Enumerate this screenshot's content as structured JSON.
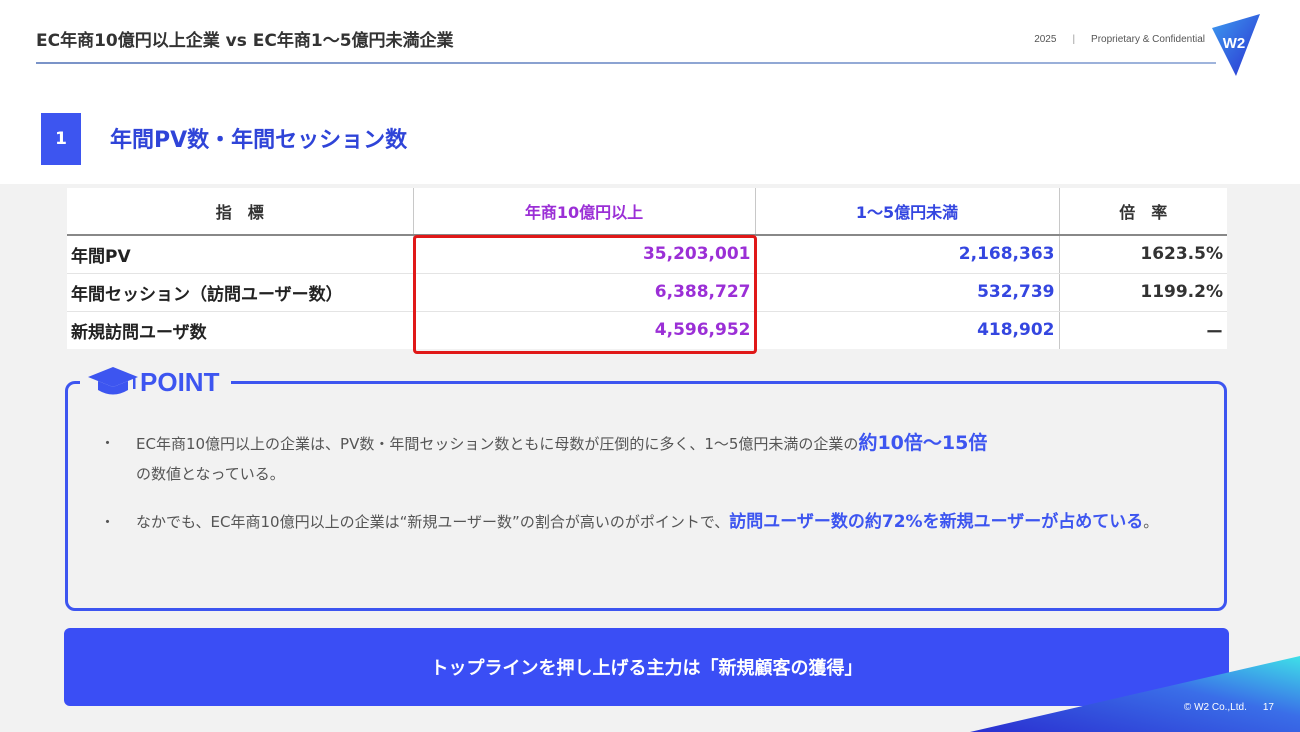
{
  "header": {
    "title": "EC年商10億円以上企業 vs EC年商1～5億円未満企業",
    "year": "2025",
    "separator": "|",
    "confidential": "Proprietary & Confidential",
    "logo_text": "W2"
  },
  "section": {
    "number": "1",
    "title": "年間PV数・年間セッション数"
  },
  "table": {
    "headers": [
      "指　標",
      "年商10億円以上",
      "1～5億円未満",
      "倍　率"
    ],
    "rows": [
      {
        "metric": "年間PV",
        "big": "35,203,001",
        "small": "2,168,363",
        "ratio": "1623.5%"
      },
      {
        "metric": "年間セッション（訪問ユーザー数）",
        "big": "6,388,727",
        "small": "532,739",
        "ratio": "1199.2%"
      },
      {
        "metric": "新規訪問ユーザ数",
        "big": "4,596,952",
        "small": "418,902",
        "ratio": "ー"
      }
    ]
  },
  "point": {
    "label": "POINT",
    "bullet_mark": "・",
    "bullet1": {
      "text": "EC年商10億円以上の企業は、PV数・年間セッション数ともに母数が圧倒的に多く、1～5億円未満の企業の",
      "emphasis": "約10倍～15倍",
      "text_after": "の数値となっている。"
    },
    "bullet2": {
      "text": "なかでも、EC年商10億円以上の企業は“新規ユーザー数”の割合が高いのがポイントで、",
      "emphasis": "訪問ユーザー数の約72%を新規ユーザーが占めている",
      "text_after": "。"
    }
  },
  "conclusion": "トップラインを押し上げる主力は「新規顧客の獲得」",
  "footer": {
    "copyright": "© W2 Co.,Ltd.",
    "page": "17"
  },
  "colors": {
    "accent_blue": "#3d55f0",
    "purple": "#9b2fd6",
    "highlight_red": "#e01818"
  }
}
